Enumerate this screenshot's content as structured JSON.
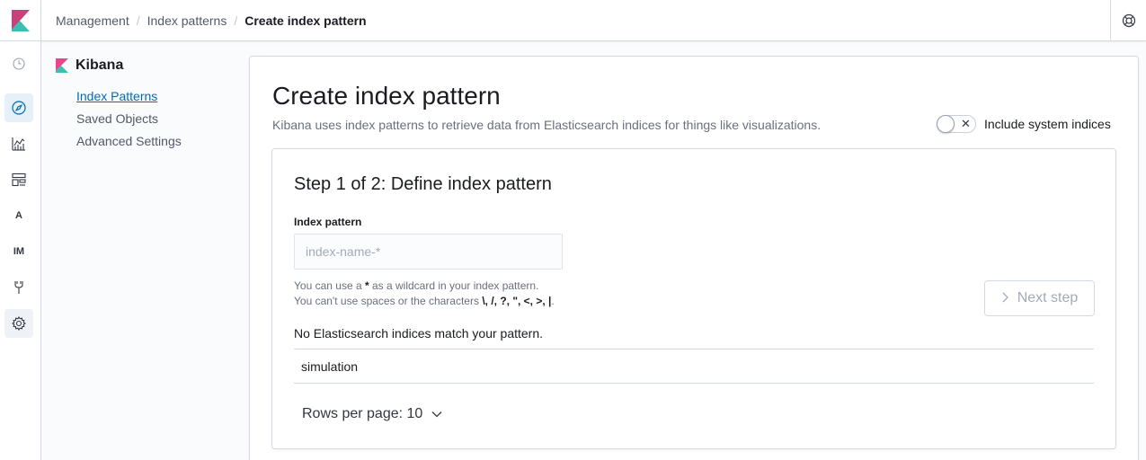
{
  "breadcrumbs": [
    {
      "label": "Management"
    },
    {
      "label": "Index patterns"
    },
    {
      "label": "Create index pattern"
    }
  ],
  "leftnav": {
    "items": [
      {
        "name": "recently-viewed",
        "label": ""
      },
      {
        "name": "discover",
        "label": "",
        "active": true
      },
      {
        "name": "visualize",
        "label": ""
      },
      {
        "name": "dashboard",
        "label": ""
      },
      {
        "name": "apm",
        "label": "A"
      },
      {
        "name": "infra-metrics",
        "label": "IM"
      },
      {
        "name": "dev-tools",
        "label": ""
      },
      {
        "name": "management",
        "label": ""
      }
    ]
  },
  "sidemenu": {
    "title": "Kibana",
    "items": [
      {
        "label": "Index Patterns",
        "active": true
      },
      {
        "label": "Saved Objects"
      },
      {
        "label": "Advanced Settings"
      }
    ]
  },
  "main": {
    "title": "Create index pattern",
    "description": "Kibana uses index patterns to retrieve data from Elasticsearch indices for things like visualizations.",
    "toggle_label": "Include system indices",
    "toggle_on": false
  },
  "step": {
    "title": "Step 1 of 2: Define index pattern",
    "field_label": "Index pattern",
    "input_value": "",
    "input_placeholder": "index-name-*",
    "help_line1_a": "You can use a ",
    "help_line1_b": "*",
    "help_line1_c": " as a wildcard in your index pattern.",
    "help_line2_a": "You can't use spaces or the characters ",
    "help_line2_b": "\\, /, ?, \", <, >, |",
    "help_line2_c": ".",
    "next_label": "Next step",
    "no_match": "No Elasticsearch indices match your pattern.",
    "rows": [
      {
        "name": "simulation"
      }
    ],
    "rows_per_page": "Rows per page: 10"
  },
  "colors": {
    "accent": "#006bb4",
    "kibana_pink": "#e8488b",
    "kibana_teal": "#3ebeb0"
  }
}
